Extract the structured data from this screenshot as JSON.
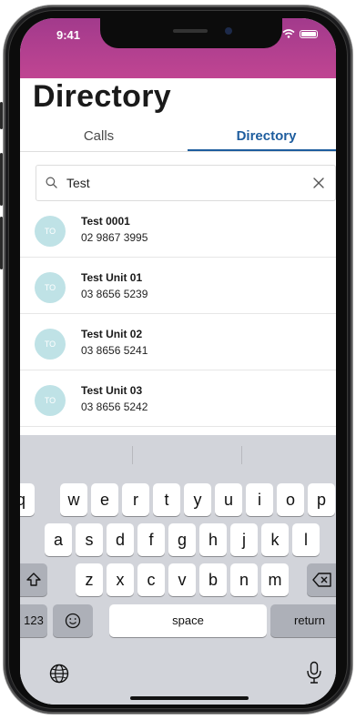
{
  "status": {
    "time": "9:41"
  },
  "header": {
    "title": "Directory"
  },
  "tabs": [
    {
      "label": "Calls",
      "active": false
    },
    {
      "label": "Directory",
      "active": true
    }
  ],
  "search": {
    "value": "Test"
  },
  "results": [
    {
      "initials": "TO",
      "name": "Test 0001",
      "phone": "02 9867 3995"
    },
    {
      "initials": "TO",
      "name": "Test Unit 01",
      "phone": "03 8656 5239"
    },
    {
      "initials": "TO",
      "name": "Test Unit 02",
      "phone": "03 8656 5241"
    },
    {
      "initials": "TO",
      "name": "Test Unit 03",
      "phone": "03 8656 5242"
    }
  ],
  "keyboard": {
    "row1": [
      "q",
      "w",
      "e",
      "r",
      "t",
      "y",
      "u",
      "i",
      "o",
      "p"
    ],
    "row2": [
      "a",
      "s",
      "d",
      "f",
      "g",
      "h",
      "j",
      "k",
      "l"
    ],
    "row3": [
      "z",
      "x",
      "c",
      "v",
      "b",
      "n",
      "m"
    ],
    "numbers_label": "123",
    "space_label": "space",
    "return_label": "return"
  },
  "colors": {
    "accent": "#1e5d9e",
    "statusbar": "#b0408f",
    "avatar": "#bfe2e6"
  },
  "icons": [
    "search-icon",
    "clear-icon",
    "shift-icon",
    "backspace-icon",
    "emoji-icon",
    "globe-icon",
    "microphone-icon"
  ]
}
